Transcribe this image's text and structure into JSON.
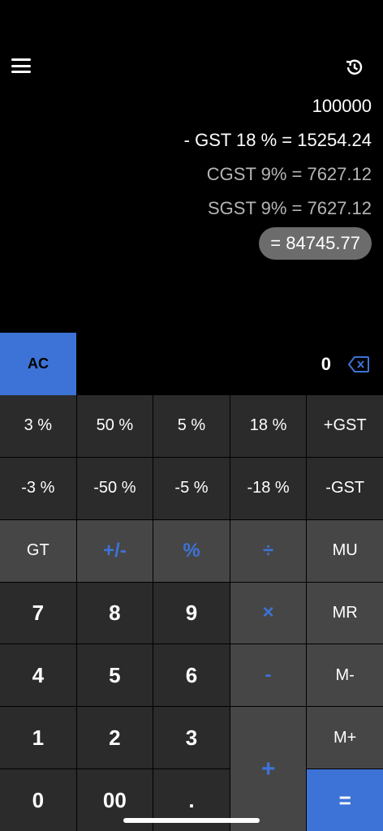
{
  "header": {
    "menu_icon": "hamburger-menu-icon",
    "history_icon": "history-clock-icon"
  },
  "tape": {
    "line1": "100000",
    "line2": "- GST 18 % = 15254.24",
    "line3": "CGST 9% = 7627.12",
    "line4": "SGST 9% = 7627.12",
    "result": "= 84745.77"
  },
  "display": {
    "ac_label": "AC",
    "current": "0",
    "backspace_icon": "backspace-icon"
  },
  "keys": {
    "plus3": "3 %",
    "plus50": "50 %",
    "plus5": "5 %",
    "plus18": "18 %",
    "plus_gst": "+GST",
    "minus3": "-3 %",
    "minus50": "-50 %",
    "minus5": "-5 %",
    "minus18": "-18 %",
    "minus_gst": "-GST",
    "gt": "GT",
    "sign": "+/-",
    "percent": "%",
    "divide": "÷",
    "mu": "MU",
    "n7": "7",
    "n8": "8",
    "n9": "9",
    "multiply": "×",
    "mr": "MR",
    "n4": "4",
    "n5": "5",
    "n6": "6",
    "subtract": "-",
    "mminus": "M-",
    "n1": "1",
    "n2": "2",
    "n3": "3",
    "add": "+",
    "mplus": "M+",
    "n0": "0",
    "n00": "00",
    "dot": ".",
    "equals": "="
  },
  "colors": {
    "accent": "#3d73d6",
    "background": "#000000",
    "key_dark": "#2b2b2b",
    "key_gray": "#464646",
    "pill": "#6c6c6c"
  }
}
